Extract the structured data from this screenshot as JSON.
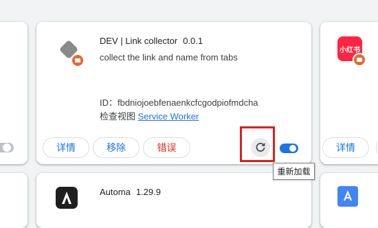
{
  "extensions": {
    "link_collector": {
      "name": "DEV | Link collector",
      "version": "0.0.1",
      "description": "collect the link and name from tabs",
      "id_text": "ID：fbdniojoebfenaenkcfcgodpiofmdcha",
      "inspect_label": "检查视图",
      "inspect_link": "Service Worker",
      "details_label": "详情",
      "remove_label": "移除",
      "errors_label": "错误",
      "enabled": true
    },
    "xiaohongshu": {
      "icon_text": "小红书",
      "details_label": "详情"
    },
    "automa": {
      "name": "Automa",
      "version": "1.29.9"
    }
  },
  "tooltip": {
    "text": "重新加载"
  },
  "colors": {
    "accent": "#1a73e8",
    "error": "#d93025",
    "toggle_on": "#1a73e8",
    "toggle_off": "#bdc1c6",
    "highlight": "#e01c1c",
    "badge": "#e8672d",
    "xhs_red": "#ff2442"
  },
  "icons": {
    "reload": "reload-icon",
    "badge": "record-badge-icon",
    "automa": "automa-logo-icon",
    "translate": "google-translate-icon"
  }
}
